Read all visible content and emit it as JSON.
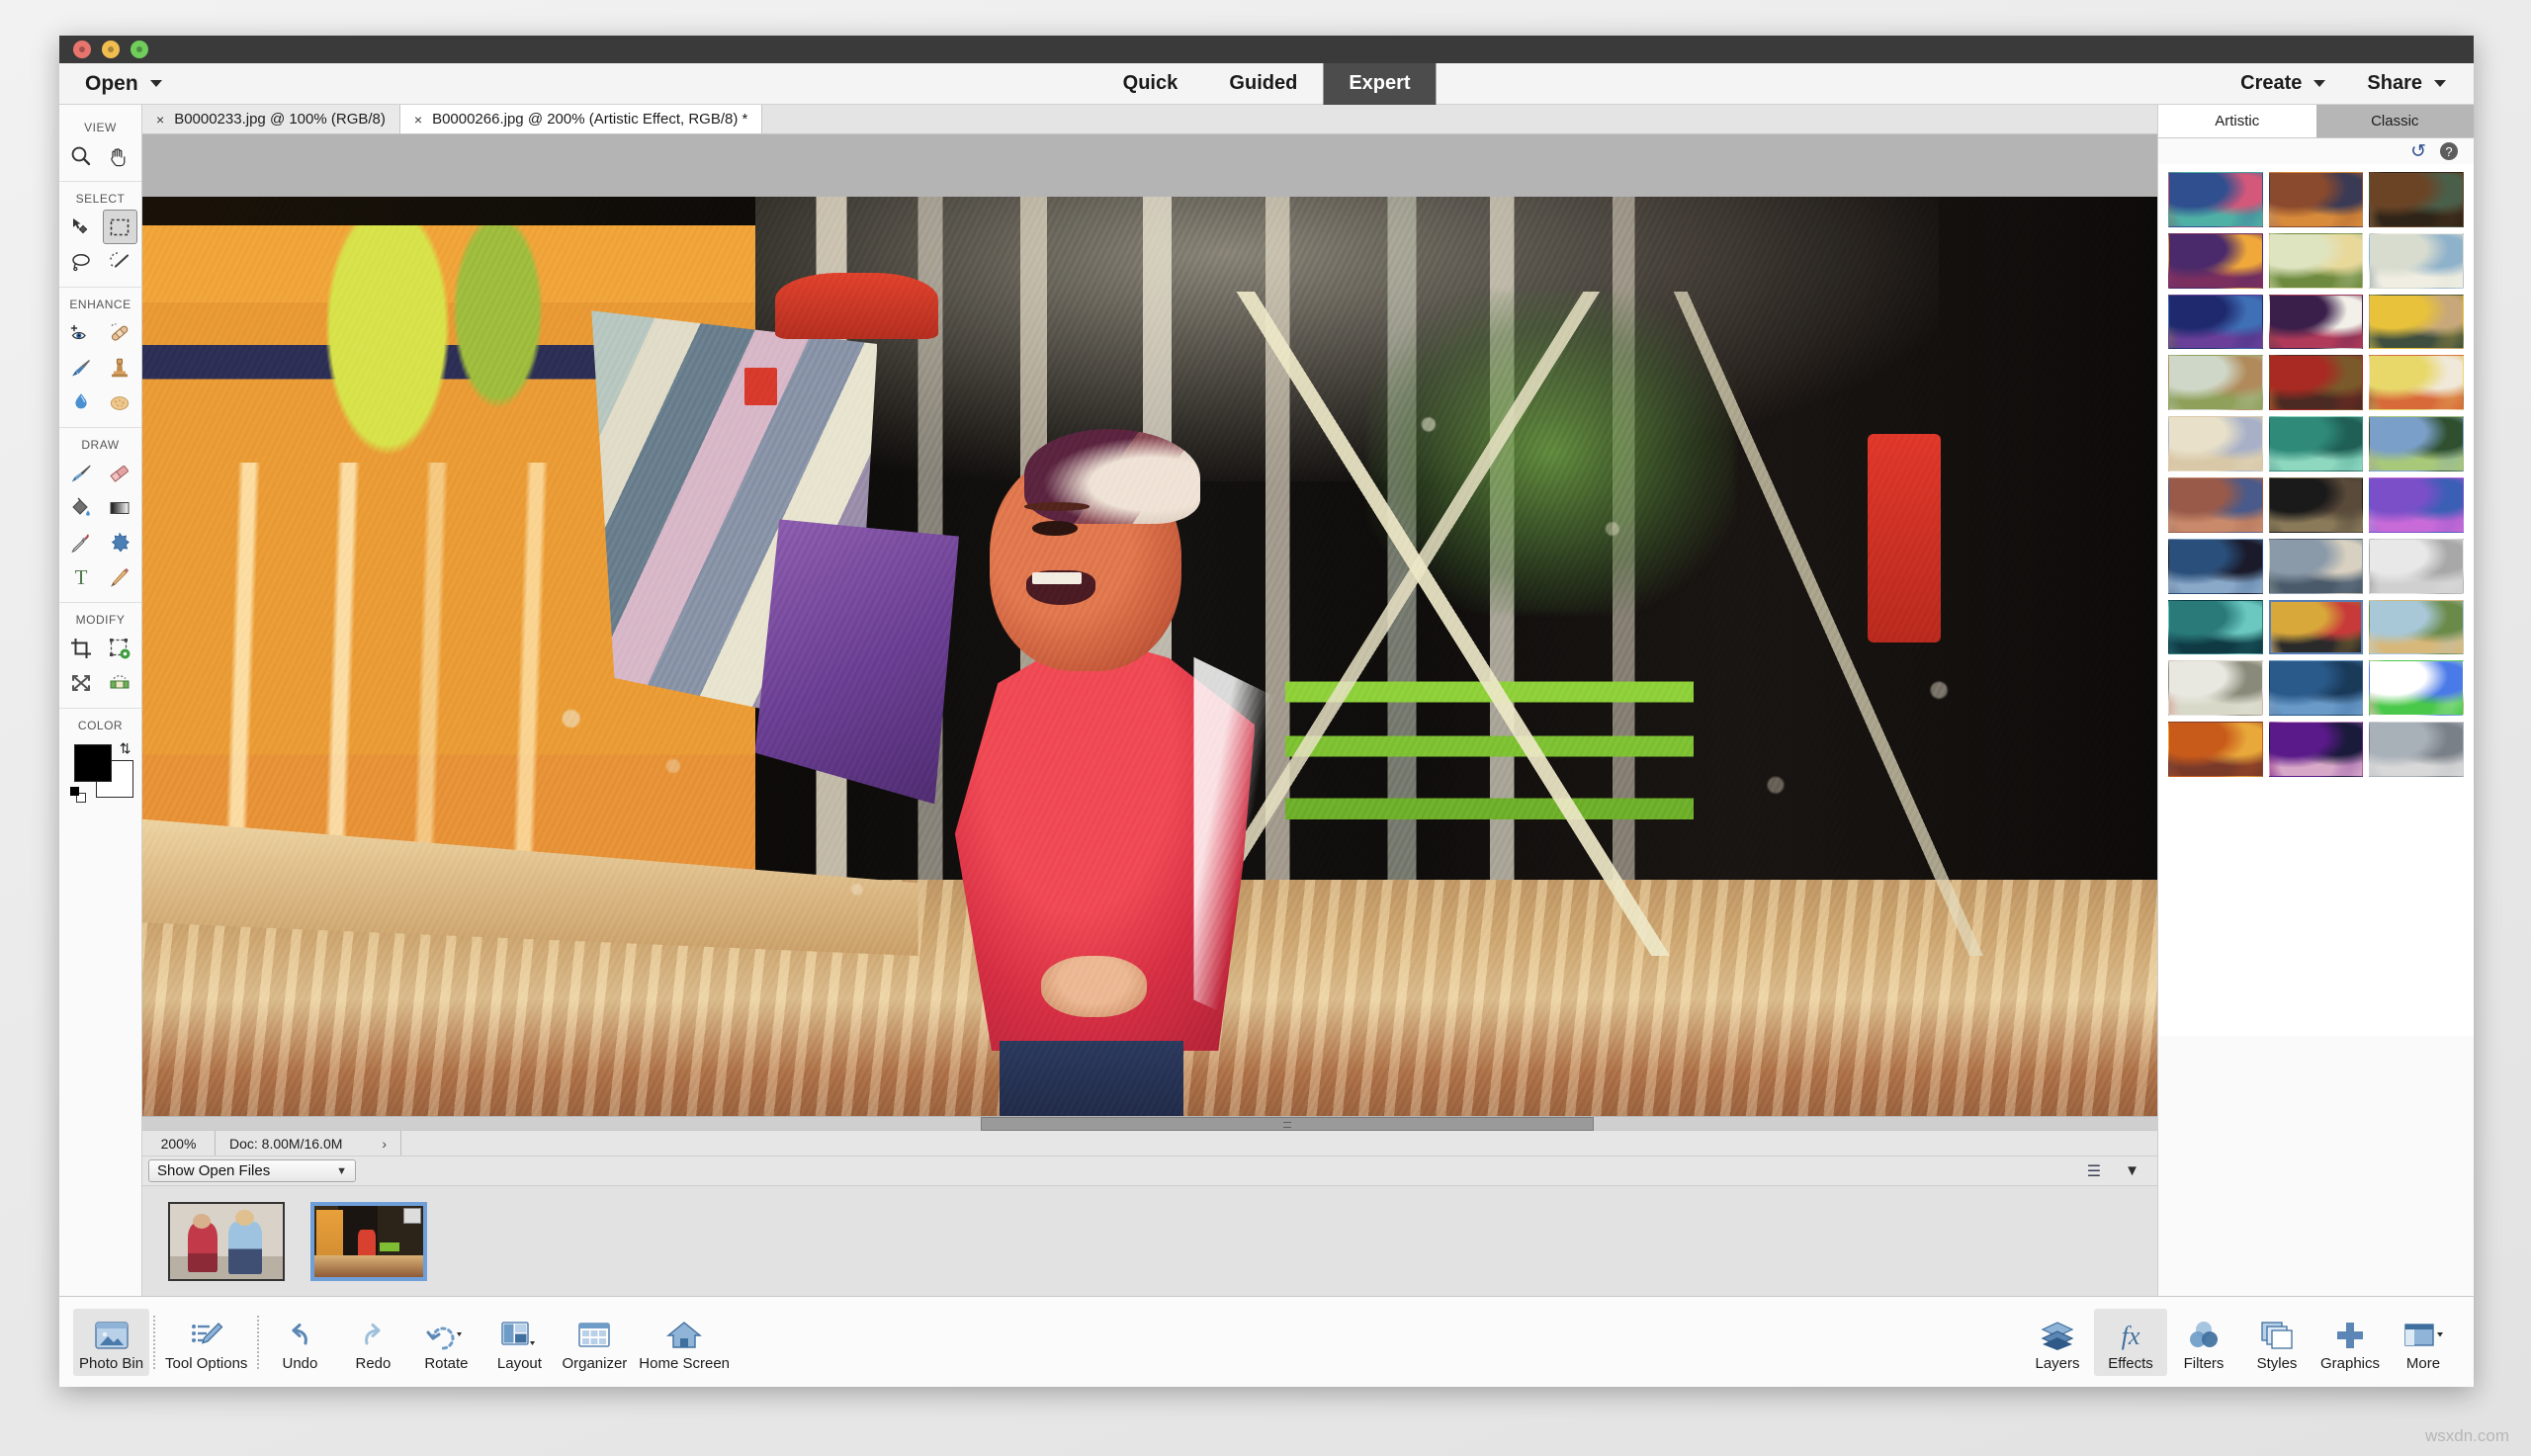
{
  "window": {
    "traffic_lights": [
      "close",
      "minimize",
      "zoom"
    ]
  },
  "menubar": {
    "open_label": "Open",
    "modes": [
      {
        "label": "Quick",
        "active": false
      },
      {
        "label": "Guided",
        "active": false
      },
      {
        "label": "Expert",
        "active": true
      }
    ],
    "right_items": [
      {
        "label": "Create"
      },
      {
        "label": "Share"
      }
    ]
  },
  "doc_tabs": [
    {
      "title": "B0000233.jpg @ 100% (RGB/8)",
      "active": false,
      "close": "×"
    },
    {
      "title": "B0000266.jpg @ 200% (Artistic Effect, RGB/8) *",
      "active": true,
      "close": "×"
    }
  ],
  "toolbox": {
    "groups": [
      {
        "label": "VIEW",
        "tools": [
          {
            "name": "zoom-tool",
            "icon": "magnifier-icon",
            "active": false
          },
          {
            "name": "hand-tool",
            "icon": "hand-icon",
            "active": false
          }
        ]
      },
      {
        "label": "SELECT",
        "tools": [
          {
            "name": "move-tool",
            "icon": "move-arrow-icon",
            "active": false
          },
          {
            "name": "rectangular-marquee-tool",
            "icon": "marquee-icon",
            "active": true
          },
          {
            "name": "lasso-tool",
            "icon": "lasso-icon",
            "active": false
          },
          {
            "name": "quick-selection-tool",
            "icon": "magic-wand-icon",
            "active": false
          }
        ]
      },
      {
        "label": "ENHANCE",
        "tools": [
          {
            "name": "red-eye-removal-tool",
            "icon": "eye-plus-icon",
            "active": false
          },
          {
            "name": "spot-healing-brush-tool",
            "icon": "bandage-icon",
            "active": false
          },
          {
            "name": "smart-brush-tool",
            "icon": "paint-brush-icon",
            "active": false
          },
          {
            "name": "clone-stamp-tool",
            "icon": "stamp-icon",
            "active": false
          },
          {
            "name": "blur-tool",
            "icon": "water-drop-icon",
            "active": false
          },
          {
            "name": "sponge-tool",
            "icon": "sponge-icon",
            "active": false
          }
        ]
      },
      {
        "label": "DRAW",
        "tools": [
          {
            "name": "brush-tool",
            "icon": "brush-icon",
            "active": false
          },
          {
            "name": "eraser-tool",
            "icon": "eraser-icon",
            "active": false
          },
          {
            "name": "paint-bucket-tool",
            "icon": "paint-bucket-icon",
            "active": false
          },
          {
            "name": "gradient-tool",
            "icon": "gradient-icon",
            "active": false
          },
          {
            "name": "color-picker-tool",
            "icon": "eyedropper-icon",
            "active": false
          },
          {
            "name": "custom-shape-tool",
            "icon": "blob-shape-icon",
            "active": false
          },
          {
            "name": "type-tool",
            "icon": "text-t-icon",
            "active": false
          },
          {
            "name": "pencil-tool",
            "icon": "pencil-icon",
            "active": false
          }
        ]
      },
      {
        "label": "MODIFY",
        "tools": [
          {
            "name": "crop-tool",
            "icon": "crop-icon",
            "active": false
          },
          {
            "name": "content-aware-move-tool",
            "icon": "transform-gear-icon",
            "active": false
          },
          {
            "name": "recompose-tool",
            "icon": "recompose-arrows-icon",
            "active": false
          },
          {
            "name": "straighten-tool",
            "icon": "straighten-icon",
            "active": false
          }
        ]
      },
      {
        "label": "COLOR",
        "tools": []
      }
    ],
    "color": {
      "foreground": "#000000",
      "background": "#ffffff",
      "swap_icon": "swap-arrows-icon",
      "default_icon": "default-colors-icon"
    }
  },
  "statusbar": {
    "zoom_level": "200%",
    "doc_size": "Doc: 8.00M/16.0M",
    "expand_arrow": "›"
  },
  "binbar": {
    "selected_filter": "Show Open Files",
    "caret": "▼",
    "sort_icon": "sort-list-icon",
    "chevron_icon": "chevron-down-icon"
  },
  "photobin": {
    "items": [
      {
        "name": "B0000233.jpg",
        "selected": false,
        "badge": false
      },
      {
        "name": "B0000266.jpg",
        "selected": true,
        "badge": true
      }
    ]
  },
  "rightpanel": {
    "tabs": [
      {
        "label": "Artistic",
        "active": true
      },
      {
        "label": "Classic",
        "active": false
      }
    ],
    "tools": [
      {
        "name": "reset-effect-icon",
        "glyph": "↺"
      },
      {
        "name": "help-icon",
        "glyph": "?"
      }
    ],
    "effects": [
      {
        "name": "cubist-portrait",
        "selected": false,
        "c1": "#2f4f8f",
        "c2": "#e8c24a",
        "c3": "#d4587a",
        "c4": "#4fb0a5"
      },
      {
        "name": "abstract-collage",
        "selected": false,
        "c1": "#8a4a2e",
        "c2": "#f2e3c8",
        "c3": "#3a3a55",
        "c4": "#d88b3a"
      },
      {
        "name": "mona-lisa",
        "selected": false,
        "c1": "#6b4426",
        "c2": "#c9a06a",
        "c3": "#4a5f4a",
        "c4": "#2e2418"
      },
      {
        "name": "expressive-portrait",
        "selected": false,
        "c1": "#4a2a6a",
        "c2": "#d63f6a",
        "c3": "#f0a83a",
        "c4": "#7a2f5f"
      },
      {
        "name": "village-landscape",
        "selected": false,
        "c1": "#dfe4c0",
        "c2": "#8fa84e",
        "c3": "#e8d89a",
        "c4": "#6d8a3e"
      },
      {
        "name": "great-wave",
        "selected": false,
        "c1": "#d8dccf",
        "c2": "#2d4f78",
        "c3": "#8fb2cb",
        "c4": "#f0eee2"
      },
      {
        "name": "starry-figures",
        "selected": false,
        "c1": "#1f2a6e",
        "c2": "#e8c23a",
        "c3": "#3f6fb5",
        "c4": "#6a3f9a"
      },
      {
        "name": "colorful-dog",
        "selected": false,
        "c1": "#3a1f4a",
        "c2": "#e06a3a",
        "c3": "#f2f0e8",
        "c4": "#b03a5a"
      },
      {
        "name": "van-gogh-portrait",
        "selected": false,
        "c1": "#e8c23a",
        "c2": "#6a8a6a",
        "c3": "#c8a87a",
        "c4": "#3f4f3f"
      },
      {
        "name": "olive-grove",
        "selected": false,
        "c1": "#cfd8c8",
        "c2": "#6a7a3a",
        "c3": "#b08a5a",
        "c4": "#8fa05a"
      },
      {
        "name": "night-cafe",
        "selected": false,
        "c1": "#a82a22",
        "c2": "#e0c03a",
        "c3": "#7a5a2a",
        "c4": "#4a2a22"
      },
      {
        "name": "modern-abstract",
        "selected": false,
        "c1": "#e8d86a",
        "c2": "#1a1a1a",
        "c3": "#f0e8d8",
        "c4": "#d86a3a"
      },
      {
        "name": "desert-sketch",
        "selected": false,
        "c1": "#e8e0c8",
        "c2": "#c89a6a",
        "c3": "#a8b0c8",
        "c4": "#d8c8a8"
      },
      {
        "name": "green-swirl",
        "selected": false,
        "c1": "#2f8a7a",
        "c2": "#d8e8e0",
        "c3": "#1f5f55",
        "c4": "#8fd8c0"
      },
      {
        "name": "cypress-field",
        "selected": false,
        "c1": "#7a9fc8",
        "c2": "#e8c23a",
        "c3": "#2f4f2f",
        "c4": "#a8c87a"
      },
      {
        "name": "boating-party",
        "selected": false,
        "c1": "#9a5a4a",
        "c2": "#d8c8b8",
        "c3": "#4a5a8a",
        "c4": "#c88a6a"
      },
      {
        "name": "concert-stage",
        "selected": false,
        "c1": "#1a1a1a",
        "c2": "#e8d88a",
        "c3": "#5a4a3a",
        "c4": "#8a7a5a"
      },
      {
        "name": "purple-fluid",
        "selected": false,
        "c1": "#7a4fc8",
        "c2": "#e8d8f0",
        "c3": "#3a5fb5",
        "c4": "#c86ad8"
      },
      {
        "name": "geometric-bird",
        "selected": false,
        "c1": "#2a4f7a",
        "c2": "#f0f0e8",
        "c3": "#1a1a2a",
        "c4": "#8aa8c8"
      },
      {
        "name": "ballet-dancers",
        "selected": false,
        "c1": "#8a9aa8",
        "c2": "#6a7a5a",
        "c3": "#d8d0c0",
        "c4": "#4a5a6a"
      },
      {
        "name": "birch-forest",
        "selected": false,
        "c1": "#e8e8e8",
        "c2": "#3a3a3a",
        "c3": "#a8a8a8",
        "c4": "#d0d0d0"
      },
      {
        "name": "teal-mosaic",
        "selected": false,
        "c1": "#2a7a7a",
        "c2": "#1a4a5a",
        "c3": "#6ac8c0",
        "c4": "#0f3a44"
      },
      {
        "name": "graffiti-cat",
        "selected": true,
        "c1": "#d8a83a",
        "c2": "#f0f0f0",
        "c3": "#c83a3a",
        "c4": "#2a2a2a"
      },
      {
        "name": "pastel-farmhouse",
        "selected": false,
        "c1": "#a8c8d8",
        "c2": "#e8d8a8",
        "c3": "#6a8a4a",
        "c4": "#d8b87a"
      },
      {
        "name": "red-poppy",
        "selected": false,
        "c1": "#e8e8e0",
        "c2": "#c82a22",
        "c3": "#8a8a7a",
        "c4": "#d8d8c8"
      },
      {
        "name": "pop-art-wolf",
        "selected": false,
        "c1": "#2a5a8a",
        "c2": "#e8e8f0",
        "c3": "#1a3a5a",
        "c4": "#6a9ac8"
      },
      {
        "name": "rainbow-watercolor",
        "selected": false,
        "c1": "#ffffff",
        "c2": "#e84a4a",
        "c3": "#4a7ae8",
        "c4": "#4ac84a"
      },
      {
        "name": "the-scream",
        "selected": false,
        "c1": "#c85a1a",
        "c2": "#2a3a5a",
        "c3": "#e8a83a",
        "c4": "#7a3a2a"
      },
      {
        "name": "neon-eye",
        "selected": false,
        "c1": "#5a1a8a",
        "c2": "#e84a7a",
        "c3": "#1a1a3a",
        "c4": "#d8a8c8"
      },
      {
        "name": "cherry-blossom",
        "selected": false,
        "c1": "#a8b0b8",
        "c2": "#f0f0f0",
        "c3": "#7a8088",
        "c4": "#d8d8d8"
      }
    ]
  },
  "taskbar": {
    "left_items": [
      {
        "label": "Photo Bin",
        "icon": "photo-bin-icon",
        "active": true
      },
      {
        "label": "Tool Options",
        "icon": "tool-options-icon",
        "active": false
      },
      {
        "label": "Undo",
        "icon": "undo-arrow-icon",
        "active": false
      },
      {
        "label": "Redo",
        "icon": "redo-arrow-icon",
        "active": false
      },
      {
        "label": "Rotate",
        "icon": "rotate-icon",
        "active": false
      },
      {
        "label": "Layout",
        "icon": "layout-icon",
        "active": false
      },
      {
        "label": "Organizer",
        "icon": "organizer-icon",
        "active": false
      },
      {
        "label": "Home Screen",
        "icon": "home-icon",
        "active": false
      }
    ],
    "right_items": [
      {
        "label": "Layers",
        "icon": "layers-icon",
        "active": false
      },
      {
        "label": "Effects",
        "icon": "fx-icon",
        "active": true
      },
      {
        "label": "Filters",
        "icon": "filters-icon",
        "active": false
      },
      {
        "label": "Styles",
        "icon": "styles-icon",
        "active": false
      },
      {
        "label": "Graphics",
        "icon": "plus-icon",
        "active": false
      },
      {
        "label": "More",
        "icon": "more-panel-icon",
        "active": false
      }
    ]
  },
  "watermark": "wsxdn.com"
}
